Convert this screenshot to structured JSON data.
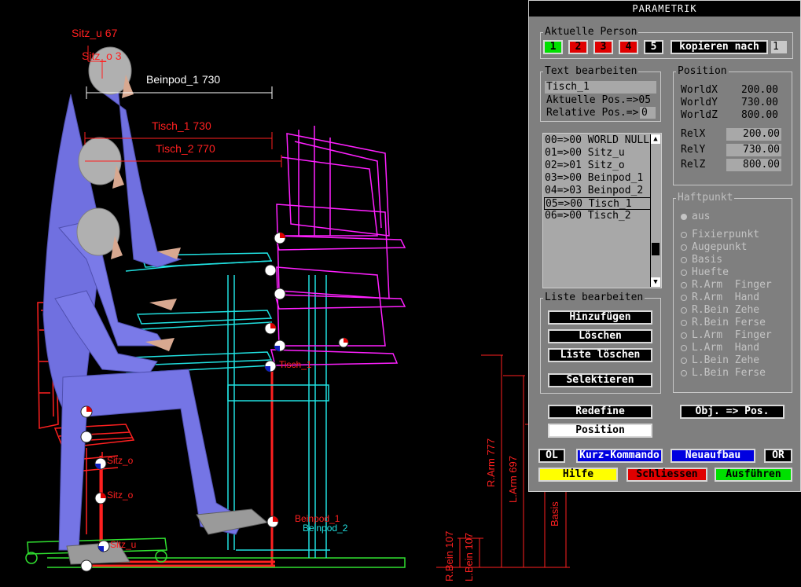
{
  "scene": {
    "labels": {
      "sitz_u_top": "Sitz_u 67",
      "sitz_o_top": "Sitz_o 3",
      "beinpod_1": "Beinpod_1 730",
      "tisch_1": "Tisch_1 730",
      "tisch_2": "Tisch_2 770",
      "tisch_1_small": "Tisch_1",
      "sitz_o_small": "Sitz_o",
      "sitz_o_small2": "Sitz_o",
      "sitz_u_small": "Sitz_u",
      "beinpod_small": "Beinpod_1",
      "beinpod_small2": "Beinpod_2",
      "r_arm": "R.Arm 777",
      "l_arm": "L.Arm 697",
      "basis": "Basis",
      "r_bein": "R.Bein 107",
      "l_bein": "L.Bein 107"
    }
  },
  "panel": {
    "title": "PARAMETRIK",
    "person": {
      "legend": "Aktuelle Person",
      "buttons": [
        "1",
        "2",
        "3",
        "4",
        "5"
      ],
      "copy_label": "kopieren nach",
      "copy_target": "1",
      "colors": [
        "#00e000",
        "#e00000",
        "#e00000",
        "#e00000",
        "#000000"
      ]
    },
    "text_edit": {
      "legend": "Text bearbeiten",
      "name_value": "Tisch_1",
      "current_pos_label": "Aktuelle Pos.=>05",
      "relative_pos_label": "Relative Pos.=>",
      "relative_pos_value": "0"
    },
    "position": {
      "legend": "Position",
      "world": [
        {
          "label": "WorldX",
          "value": "200.00"
        },
        {
          "label": "WorldY",
          "value": "730.00"
        },
        {
          "label": "WorldZ",
          "value": "800.00"
        }
      ],
      "rel": [
        {
          "label": "RelX",
          "value": "200.00"
        },
        {
          "label": "RelY",
          "value": "730.00"
        },
        {
          "label": "RelZ",
          "value": "800.00"
        }
      ]
    },
    "list": {
      "items": [
        "00=>00 WORLD NULL",
        "01=>00 Sitz_u",
        "02=>01 Sitz_o",
        "03=>00 Beinpod_1",
        "04=>03 Beinpod_2",
        "05=>00 Tisch_1",
        "06=>00 Tisch_2"
      ],
      "selected_index": 5
    },
    "list_edit": {
      "legend": "Liste bearbeiten",
      "add": "Hinzufügen",
      "delete": "Löschen",
      "clear": "Liste löschen",
      "select": "Selektieren"
    },
    "haftpunkt": {
      "legend": "Haftpunkt",
      "options": [
        "aus",
        "Fixierpunkt",
        "Augepunkt",
        "Basis",
        "Huefte",
        "R.Arm  Finger",
        "R.Arm  Hand",
        "R.Bein Zehe",
        "R.Bein Ferse",
        "L.Arm  Finger",
        "L.Arm  Hand",
        "L.Bein Zehe",
        "L.Bein Ferse"
      ],
      "selected_index": 0
    },
    "buttons": {
      "redefine": "Redefine",
      "position": "Position",
      "obj_pos": "Obj. => Pos.",
      "ol": "OL",
      "kurz": "Kurz-Kommando",
      "neuaufbau": "Neuaufbau",
      "or": "OR",
      "hilfe": "Hilfe",
      "schliessen": "Schliessen",
      "ausfuehren": "Ausführen"
    }
  }
}
